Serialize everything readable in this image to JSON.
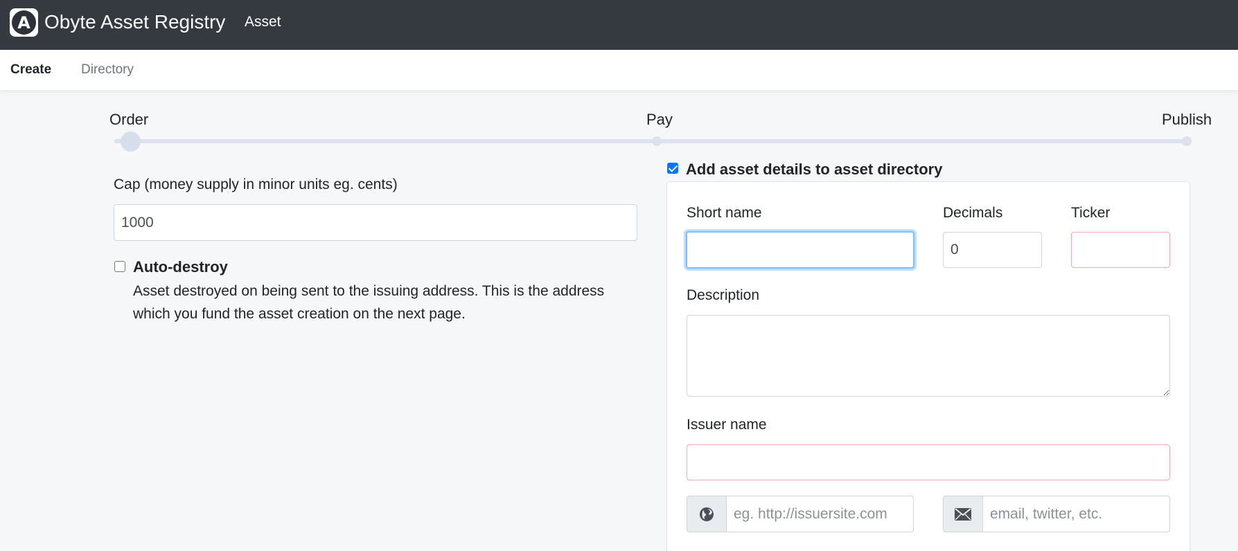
{
  "header": {
    "logo_letter": "A",
    "brand": "Obyte Asset Registry",
    "nav_asset": "Asset"
  },
  "subnav": {
    "items": [
      {
        "label": "Create",
        "active": true
      },
      {
        "label": "Directory",
        "active": false
      }
    ]
  },
  "stepper": {
    "steps": [
      "Order",
      "Pay",
      "Publish"
    ],
    "current": 0
  },
  "form": {
    "cap_label": "Cap (money supply in minor units eg. cents)",
    "cap_value": "1000",
    "auto_destroy": {
      "label": "Auto-destroy",
      "checked": false,
      "description": "Asset destroyed on being sent to the issuing address. This is the address which you fund the asset creation on the next page."
    }
  },
  "directory": {
    "checkbox_label": "Add asset details to asset directory",
    "checked": true,
    "short_name_label": "Short name",
    "short_name_value": "",
    "decimals_label": "Decimals",
    "decimals_value": "0",
    "ticker_label": "Ticker",
    "ticker_value": "",
    "description_label": "Description",
    "description_value": "",
    "issuer_name_label": "Issuer name",
    "issuer_name_value": "",
    "website_placeholder": "eg. http://issuersite.com",
    "contact_placeholder": "email, twitter, etc."
  },
  "icons": {
    "website": "globe-icon",
    "contact": "envelope-icon"
  },
  "colors": {
    "navbar": "#343a40",
    "focus_border": "#80bdff",
    "invalid_border": "#f1aab8",
    "checkbox_checked": "#0075ff"
  }
}
